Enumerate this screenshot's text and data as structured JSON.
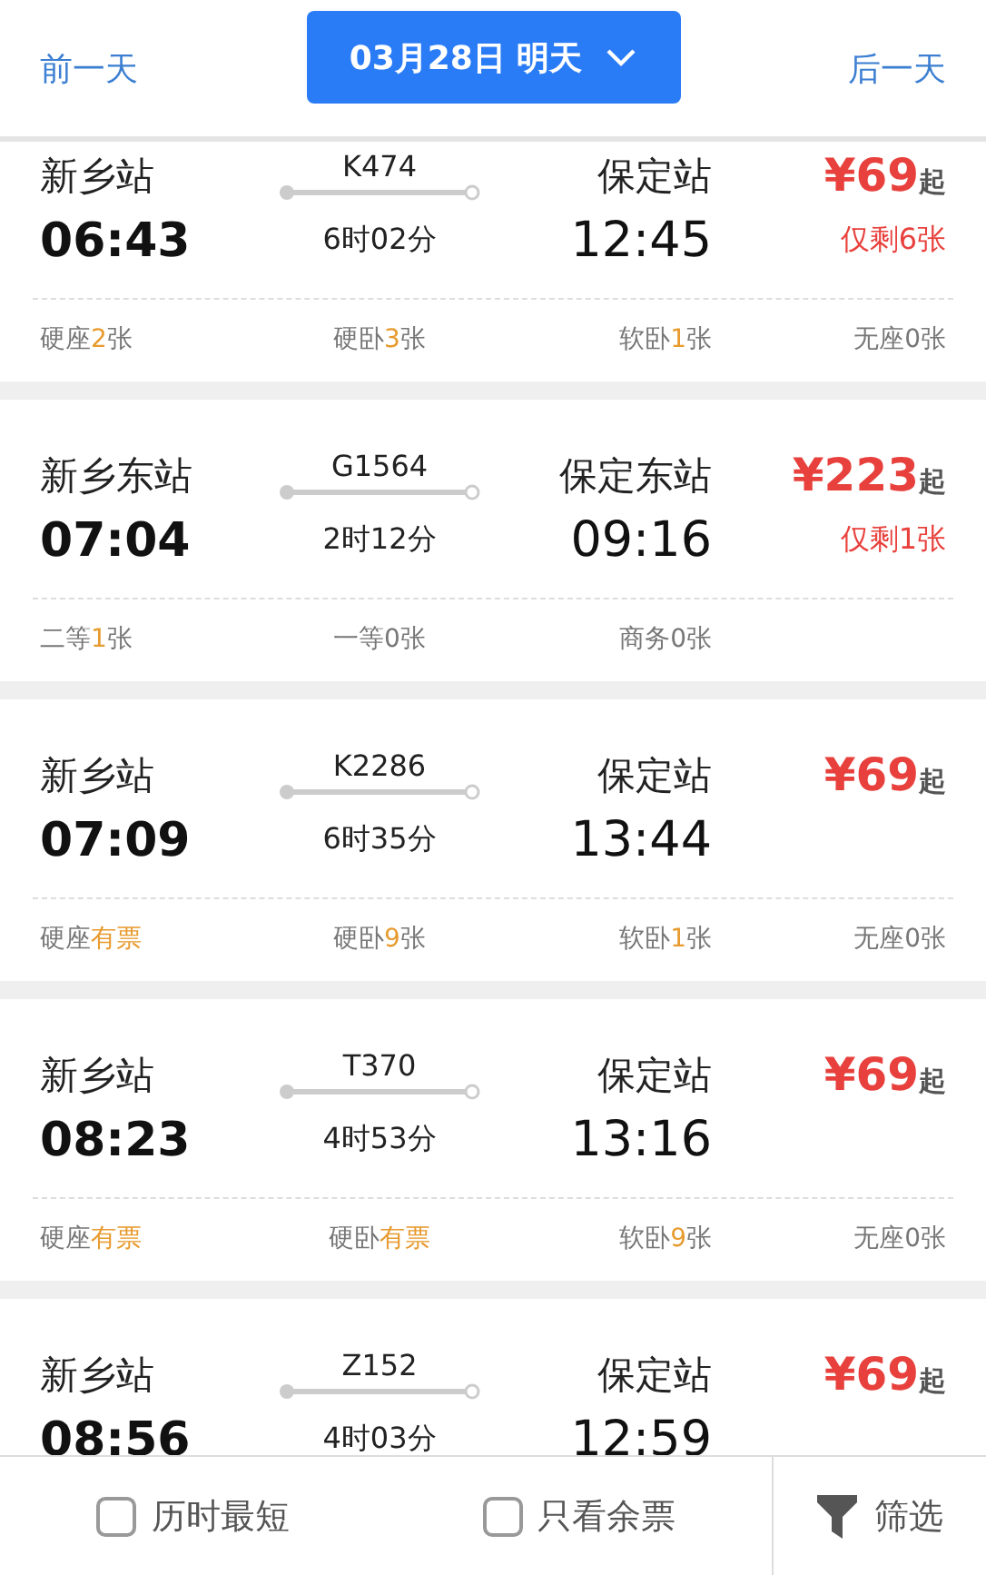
{
  "header": {
    "prev_day": "前一天",
    "date": "03月28日 明天",
    "next_day": "后一天"
  },
  "trains": [
    {
      "from": "新乡站",
      "depart": "06:43",
      "number": "K474",
      "duration": "6时02分",
      "to": "保定站",
      "arrive": "12:45",
      "price": "¥69",
      "price_suffix": "起",
      "remaining": "仅剩6张",
      "seats": [
        {
          "type": "硬座",
          "count": "2",
          "unit": "张",
          "available": true
        },
        {
          "type": "硬卧",
          "count": "3",
          "unit": "张",
          "available": true
        },
        {
          "type": "软卧",
          "count": "1",
          "unit": "张",
          "available": true
        },
        {
          "type": "无座",
          "count": "0",
          "unit": "张",
          "available": false
        }
      ]
    },
    {
      "from": "新乡东站",
      "depart": "07:04",
      "number": "G1564",
      "duration": "2时12分",
      "to": "保定东站",
      "arrive": "09:16",
      "price": "¥223",
      "price_suffix": "起",
      "remaining": "仅剩1张",
      "seats": [
        {
          "type": "二等",
          "count": "1",
          "unit": "张",
          "available": true
        },
        {
          "type": "一等",
          "count": "0",
          "unit": "张",
          "available": false
        },
        {
          "type": "商务",
          "count": "0",
          "unit": "张",
          "available": false
        }
      ]
    },
    {
      "from": "新乡站",
      "depart": "07:09",
      "number": "K2286",
      "duration": "6时35分",
      "to": "保定站",
      "arrive": "13:44",
      "price": "¥69",
      "price_suffix": "起",
      "seats": [
        {
          "type": "硬座",
          "count": "有票",
          "available": true
        },
        {
          "type": "硬卧",
          "count": "9",
          "unit": "张",
          "available": true
        },
        {
          "type": "软卧",
          "count": "1",
          "unit": "张",
          "available": true
        },
        {
          "type": "无座",
          "count": "0",
          "unit": "张",
          "available": false
        }
      ]
    },
    {
      "from": "新乡站",
      "depart": "08:23",
      "number": "T370",
      "duration": "4时53分",
      "to": "保定站",
      "arrive": "13:16",
      "price": "¥69",
      "price_suffix": "起",
      "seats": [
        {
          "type": "硬座",
          "count": "有票",
          "available": true
        },
        {
          "type": "硬卧",
          "count": "有票",
          "available": true
        },
        {
          "type": "软卧",
          "count": "9",
          "unit": "张",
          "available": true
        },
        {
          "type": "无座",
          "count": "0",
          "unit": "张",
          "available": false
        }
      ]
    },
    {
      "from": "新乡站",
      "depart": "08:56",
      "number": "Z152",
      "duration": "4时03分",
      "to": "保定站",
      "arrive": "12:59",
      "price": "¥69",
      "price_suffix": "起"
    }
  ],
  "bottom_bar": {
    "options": [
      {
        "label": "历时最短",
        "checked": false
      },
      {
        "label": "只看余票",
        "checked": false
      }
    ],
    "filter": "筛选"
  }
}
